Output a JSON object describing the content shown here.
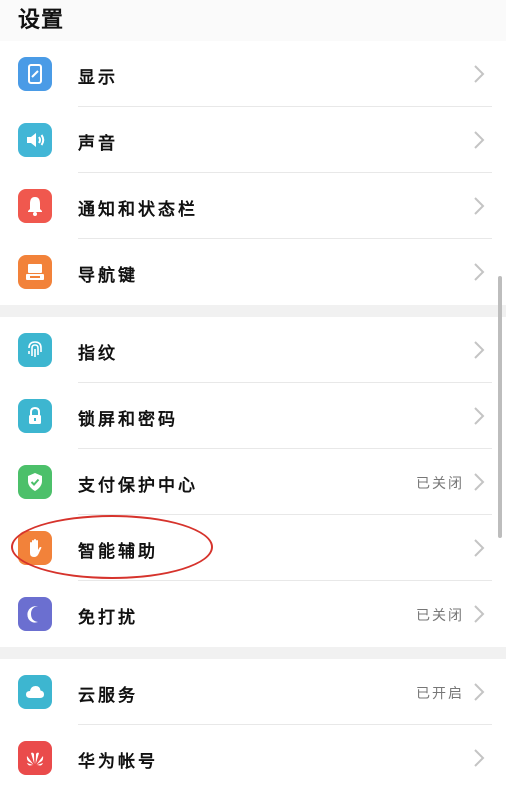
{
  "header": {
    "title": "设置"
  },
  "sections": [
    {
      "items": [
        {
          "name": "display",
          "icon": "phone-display-icon",
          "color": "#4a9be6",
          "label": "显示",
          "status": ""
        },
        {
          "name": "sound",
          "icon": "speaker-icon",
          "color": "#42b6d6",
          "label": "声音",
          "status": ""
        },
        {
          "name": "notifications",
          "icon": "bell-icon",
          "color": "#f0584e",
          "label": "通知和状态栏",
          "status": ""
        },
        {
          "name": "nav-keys",
          "icon": "keyboard-icon",
          "color": "#f2823a",
          "label": "导航键",
          "status": ""
        }
      ]
    },
    {
      "items": [
        {
          "name": "fingerprint",
          "icon": "fingerprint-icon",
          "color": "#3db6d0",
          "label": "指纹",
          "status": ""
        },
        {
          "name": "lock-screen",
          "icon": "lock-icon",
          "color": "#3db6d0",
          "label": "锁屏和密码",
          "status": ""
        },
        {
          "name": "payment-protection",
          "icon": "shield-check-icon",
          "color": "#4cc06a",
          "label": "支付保护中心",
          "status": "已关闭"
        },
        {
          "name": "accessibility",
          "icon": "hand-icon",
          "color": "#f2823a",
          "label": "智能辅助",
          "status": ""
        },
        {
          "name": "do-not-disturb",
          "icon": "moon-icon",
          "color": "#6b6fd0",
          "label": "免打扰",
          "status": "已关闭"
        }
      ]
    },
    {
      "items": [
        {
          "name": "cloud",
          "icon": "cloud-icon",
          "color": "#3db6d0",
          "label": "云服务",
          "status": "已开启"
        },
        {
          "name": "huawei-account",
          "icon": "huawei-logo-icon",
          "color": "#ea4b4b",
          "label": "华为帐号",
          "status": ""
        }
      ]
    }
  ]
}
